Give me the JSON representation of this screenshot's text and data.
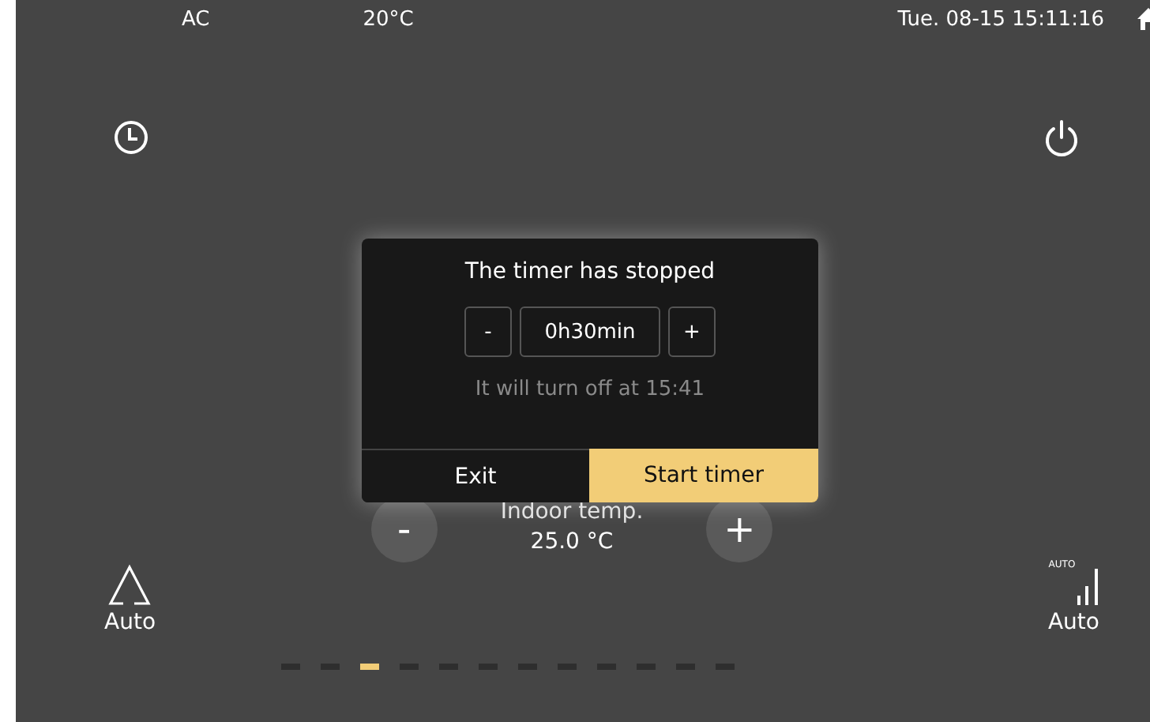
{
  "status_bar": {
    "mode": "AC",
    "outdoor_temp": "20°C",
    "datetime": "Tue. 08-15 15:11:16"
  },
  "indoor": {
    "label": "Indoor temp.",
    "value": "25.0 °C",
    "minus": "-",
    "plus": "+"
  },
  "mode": {
    "label": "Auto"
  },
  "fan": {
    "badge": "AUTO",
    "label": "Auto"
  },
  "pages": [
    {
      "selected": false
    },
    {
      "selected": false
    },
    {
      "selected": true
    },
    {
      "selected": false
    },
    {
      "selected": false
    },
    {
      "selected": false
    },
    {
      "selected": false
    },
    {
      "selected": false
    },
    {
      "selected": false
    },
    {
      "selected": false
    },
    {
      "selected": false
    },
    {
      "selected": false
    }
  ],
  "dialog": {
    "title": "The timer has stopped",
    "decrement": "-",
    "duration": "0h30min",
    "increment": "+",
    "info": "It will turn off at 15:41",
    "buttons": [
      {
        "label": "Exit",
        "kind": "secondary"
      },
      {
        "label": "Start timer",
        "kind": "primary"
      }
    ]
  }
}
